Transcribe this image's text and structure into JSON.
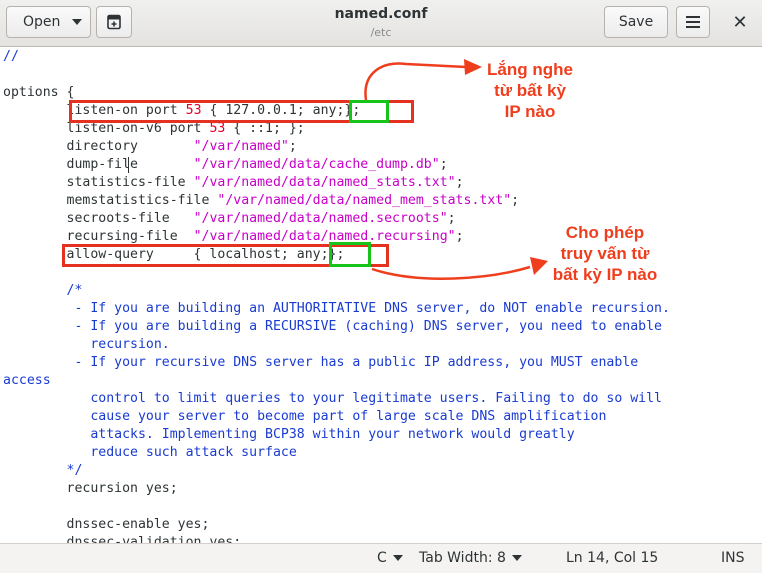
{
  "header": {
    "open_label": "Open",
    "new_doc_icon": "new-document-icon",
    "title": "named.conf",
    "subtitle": "/etc",
    "save_label": "Save",
    "menu_icon": "hamburger-menu-icon",
    "close_glyph": "✕"
  },
  "code": {
    "l1": "//",
    "l3": "options {",
    "l4a": "        listen-on port ",
    "l4b": "53",
    "l4c": " { 127.0.0.1; any;};",
    "l5a": "        listen-on-v6 port ",
    "l5b": "53",
    "l5c": " { ::1; };",
    "l6a": "        directory       ",
    "l6b": "\"/var/named\"",
    "l6c": ";",
    "l7a": "        dump-file       ",
    "l7b": "\"/var/named/data/cache_dump.db\"",
    "l7c": ";",
    "l8a": "        statistics-file ",
    "l8b": "\"/var/named/data/named_stats.txt\"",
    "l8c": ";",
    "l9a": "        memstatistics-file ",
    "l9b": "\"/var/named/data/named_mem_stats.txt\"",
    "l9c": ";",
    "l10a": "        secroots-file   ",
    "l10b": "\"/var/named/data/named.secroots\"",
    "l10c": ";",
    "l11a": "        recursing-file  ",
    "l11b": "\"/var/named/data/named.recursing\"",
    "l11c": ";",
    "l12": "        allow-query     { localhost; any;};",
    "l14": "        /*",
    "l15": "         - If you are building an AUTHORITATIVE DNS server, do NOT enable recursion.",
    "l16": "         - If you are building a RECURSIVE (caching) DNS server, you need to enable",
    "l17": "           recursion.",
    "l18": "         - If your recursive DNS server has a public IP address, you MUST enable",
    "l19": "access",
    "l20": "           control to limit queries to your legitimate users. Failing to do so will",
    "l21": "           cause your server to become part of large scale DNS amplification",
    "l22": "           attacks. Implementing BCP38 within your network would greatly",
    "l23": "           reduce such attack surface",
    "l24": "        */",
    "l25": "        recursion yes;",
    "l27": "        dnssec-enable yes;",
    "l28": "        dnssec-validation yes;"
  },
  "annotations": {
    "listen_note_1": "Lắng nghe",
    "listen_note_2": "từ bất kỳ",
    "listen_note_3": "IP nào",
    "query_note_1": "Cho phép",
    "query_note_2": "truy vấn từ",
    "query_note_3": "bất kỳ IP nào",
    "highlight_color": "#e53120",
    "value_box_color": "#19c41a"
  },
  "status": {
    "language": "C",
    "tab_width": "Tab Width: 8",
    "position": "Ln 14, Col 15",
    "mode": "INS"
  }
}
